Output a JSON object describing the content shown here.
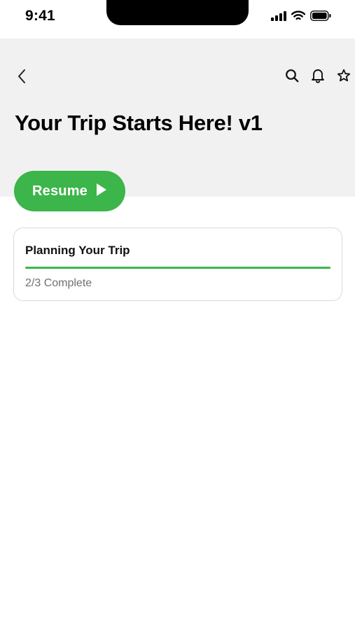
{
  "status_bar": {
    "time": "9:41"
  },
  "header": {
    "title": "Your Trip Starts Here! v1",
    "icons": [
      "back-icon",
      "search-icon",
      "bell-icon",
      "star-icon"
    ]
  },
  "resume_button": {
    "label": "Resume",
    "icon": "play-icon"
  },
  "course_card": {
    "title": "Planning Your Trip",
    "status": "2/3 Complete",
    "progress": 1.0
  },
  "colors": {
    "accent": "#3cb54a",
    "header_background": "#f1f1f1",
    "card_border": "#d9d9d9",
    "muted_text": "#6f6f6f"
  }
}
